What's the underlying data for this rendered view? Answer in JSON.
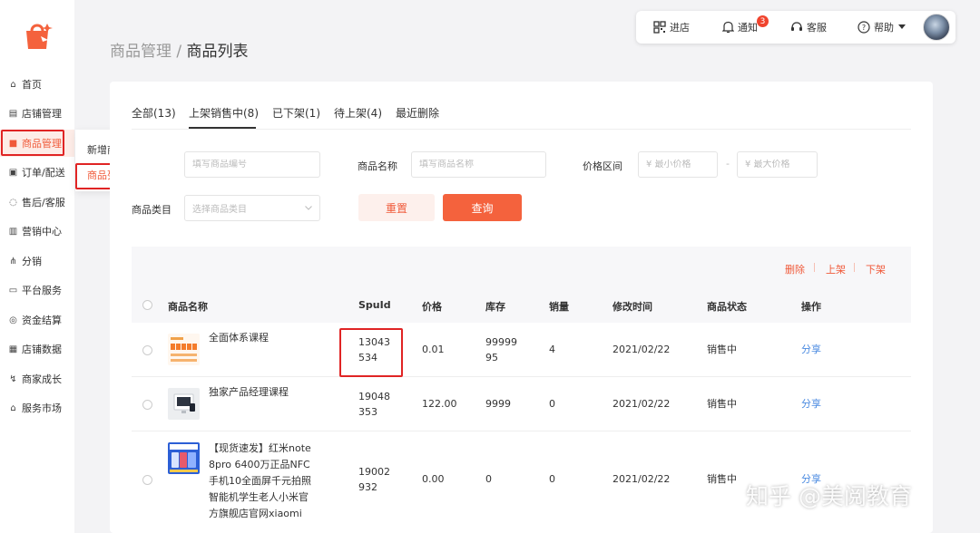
{
  "sidebar": {
    "items": [
      {
        "label": "首页",
        "icon": "home-icon"
      },
      {
        "label": "店铺管理",
        "icon": "store-icon"
      },
      {
        "label": "商品管理",
        "icon": "bag-icon"
      },
      {
        "label": "订单/配送",
        "icon": "order-icon"
      },
      {
        "label": "售后/客服",
        "icon": "service-icon"
      },
      {
        "label": "营销中心",
        "icon": "marketing-icon"
      },
      {
        "label": "分销",
        "icon": "distribution-icon"
      },
      {
        "label": "平台服务",
        "icon": "platform-icon"
      },
      {
        "label": "资金结算",
        "icon": "money-icon"
      },
      {
        "label": "店铺数据",
        "icon": "data-icon"
      },
      {
        "label": "商家成长",
        "icon": "growth-icon"
      },
      {
        "label": "服务市场",
        "icon": "market-icon"
      }
    ],
    "submenu": [
      "新增商品",
      "商品列表"
    ]
  },
  "topbar": {
    "store": "进店",
    "notice": "通知",
    "notice_count": "3",
    "service": "客服",
    "help": "帮助"
  },
  "breadcrumb": {
    "parent": "商品管理",
    "sep": " / ",
    "current": "商品列表"
  },
  "tabs": [
    "全部(13)",
    "上架销售中(8)",
    "已下架(1)",
    "待上架(4)",
    "最近删除"
  ],
  "filters": {
    "code_placeholder": "填写商品编号",
    "name_label": "商品名称",
    "name_placeholder": "填写商品名称",
    "price_label": "价格区间",
    "min_price": "¥ 最小价格",
    "max_price": "¥ 最大价格",
    "dash": "-",
    "category_label": "商品类目",
    "category_placeholder": "选择商品类目",
    "reset": "重置",
    "query": "查询"
  },
  "actions": {
    "delete": "删除",
    "on_shelf": "上架",
    "off_shelf": "下架"
  },
  "table": {
    "headers": [
      "商品名称",
      "SpuId",
      "价格",
      "库存",
      "销量",
      "修改时间",
      "商品状态",
      "操作"
    ],
    "rows": [
      {
        "name": "全面体系课程",
        "spu1": "13043",
        "spu2": "534",
        "price": "0.01",
        "stock1": "99999",
        "stock2": "95",
        "sales": "4",
        "date": "2021/02/22",
        "status": "销售中",
        "op": "分享"
      },
      {
        "name": "独家产品经理课程",
        "spu1": "19048",
        "spu2": "353",
        "price": "122.00",
        "stock1": "9999",
        "stock2": "",
        "sales": "0",
        "date": "2021/02/22",
        "status": "销售中",
        "op": "分享"
      },
      {
        "name1": "【现货速发】红米note",
        "name2": "8pro 6400万正品NFC",
        "name3": "手机10全面屏千元拍照",
        "name4": "智能机学生老人小米官",
        "name5": "方旗舰店官网xiaomi",
        "spu1": "19002",
        "spu2": "932",
        "price": "0.00",
        "stock1": "0",
        "sales": "0",
        "date": "2021/02/22",
        "status": "销售中",
        "op": "分享"
      }
    ]
  },
  "watermark": "知乎 @美阅教育",
  "colors": {
    "accent": "#f4623d",
    "link": "#4a8ae0",
    "highlight": "#e02424"
  }
}
